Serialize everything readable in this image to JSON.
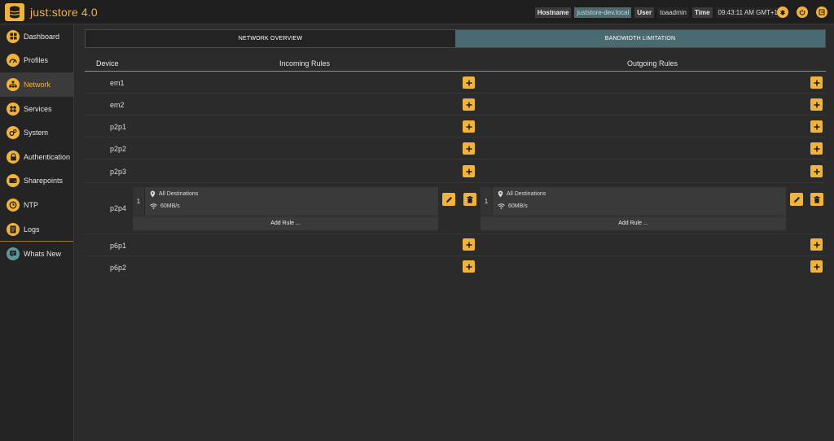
{
  "app": {
    "brand": "just",
    "brand_sep": ":",
    "brand_name": "store",
    "version": "4.0"
  },
  "topbar": {
    "hostname_label": "Hostname",
    "hostname_value": "juststore-dev.local",
    "user_label": "User",
    "user_value": "toaadmin",
    "time_label": "Time",
    "time_value": "09:43:11 AM GMT+1",
    "icons": [
      "bug-icon",
      "power-icon",
      "logout-icon"
    ]
  },
  "sidebar": {
    "items": [
      {
        "label": "Dashboard",
        "icon": "dashboard-icon"
      },
      {
        "label": "Profiles",
        "icon": "gauge-icon"
      },
      {
        "label": "Network",
        "icon": "network-icon",
        "active": true
      },
      {
        "label": "Services",
        "icon": "services-icon"
      },
      {
        "label": "System",
        "icon": "gears-icon"
      },
      {
        "label": "Authentication",
        "icon": "lock-icon"
      },
      {
        "label": "Sharepoints",
        "icon": "drive-icon"
      },
      {
        "label": "NTP",
        "icon": "clock-icon"
      },
      {
        "label": "Logs",
        "icon": "document-icon"
      }
    ],
    "extra": {
      "label": "Whats New",
      "icon": "chat-icon"
    }
  },
  "tabs": [
    {
      "label": "NETWORK OVERVIEW",
      "active": false
    },
    {
      "label": "BANDWIDTH LIMITATION",
      "active": true
    }
  ],
  "table": {
    "headers": {
      "device": "Device",
      "incoming": "Incoming Rules",
      "outgoing": "Outgoing Rules"
    },
    "devices": [
      "em1",
      "em2",
      "p2p1",
      "p2p2",
      "p2p3",
      "p2p4",
      "p6p1",
      "p6p2"
    ],
    "expanded": {
      "device": "p2p4",
      "incoming_rule": {
        "number": "1",
        "destination": "All Destinations",
        "rate": "60MB/s"
      },
      "outgoing_rule": {
        "number": "1",
        "destination": "All Destinations",
        "rate": "60MB/s"
      },
      "add_rule_label": "Add Rule ..."
    }
  },
  "colors": {
    "accent": "#f2b33d",
    "active_tab": "#4a6a72",
    "background": "#2b2b2b"
  }
}
